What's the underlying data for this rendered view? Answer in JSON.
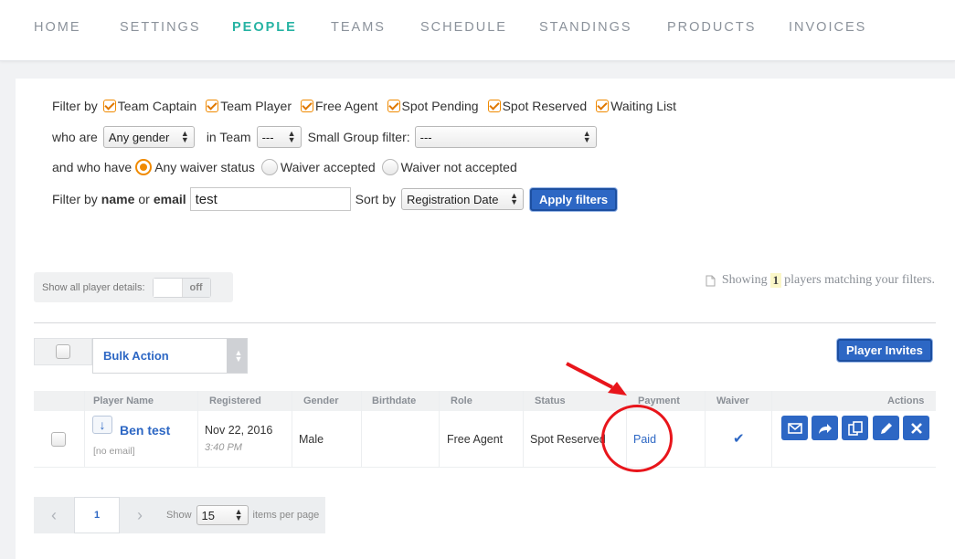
{
  "nav": {
    "tabs": [
      "HOME",
      "SETTINGS",
      "PEOPLE",
      "TEAMS",
      "SCHEDULE",
      "STANDINGS",
      "PRODUCTS",
      "INVOICES"
    ],
    "active": "PEOPLE"
  },
  "filters": {
    "filter_by_label": "Filter by",
    "roles": [
      "Team Captain",
      "Team Player",
      "Free Agent",
      "Spot Pending",
      "Spot Reserved",
      "Waiting List"
    ],
    "who_are_label": "who are",
    "gender_value": "Any gender",
    "in_team_label": "in Team",
    "team_value": "---",
    "small_group_label": "Small Group filter:",
    "small_group_value": "---",
    "and_who_have_label": "and who have",
    "waiver_options": [
      "Any waiver status",
      "Waiver accepted",
      "Waiver not accepted"
    ],
    "waiver_selected": "Any waiver status",
    "filter_prefix": "Filter by",
    "name_label": "name",
    "or_label": "or",
    "email_label": "email",
    "search_value": "test",
    "sort_by_label": "Sort by",
    "sort_value": "Registration Date",
    "apply_label": "Apply filters"
  },
  "details_toggle": {
    "label": "Show all player details:",
    "state": "off"
  },
  "showing": {
    "prefix": "Showing",
    "count": "1",
    "suffix": "players matching your filters."
  },
  "bulk": {
    "label": "Bulk Action"
  },
  "player_invites_label": "Player Invites",
  "table": {
    "headers": [
      "Player Name",
      "Registered",
      "Gender",
      "Birthdate",
      "Role",
      "Status",
      "Payment",
      "Waiver",
      "Actions"
    ],
    "rows": [
      {
        "name": "Ben test",
        "email": "[no email]",
        "registered_date": "Nov 22, 2016",
        "registered_time": "3:40 PM",
        "gender": "Male",
        "birthdate": "",
        "role": "Free Agent",
        "status": "Spot Reserved",
        "payment": "Paid",
        "waiver": "✔"
      }
    ]
  },
  "pagination": {
    "prev": "‹",
    "current": "1",
    "next": "›",
    "show_label": "Show",
    "per_page": "15",
    "items_label": "items per page"
  },
  "colors": {
    "accent": "#26b3a3",
    "primary": "#2d67c4",
    "checkbox": "#f08a00",
    "annotation": "#e8151b"
  }
}
